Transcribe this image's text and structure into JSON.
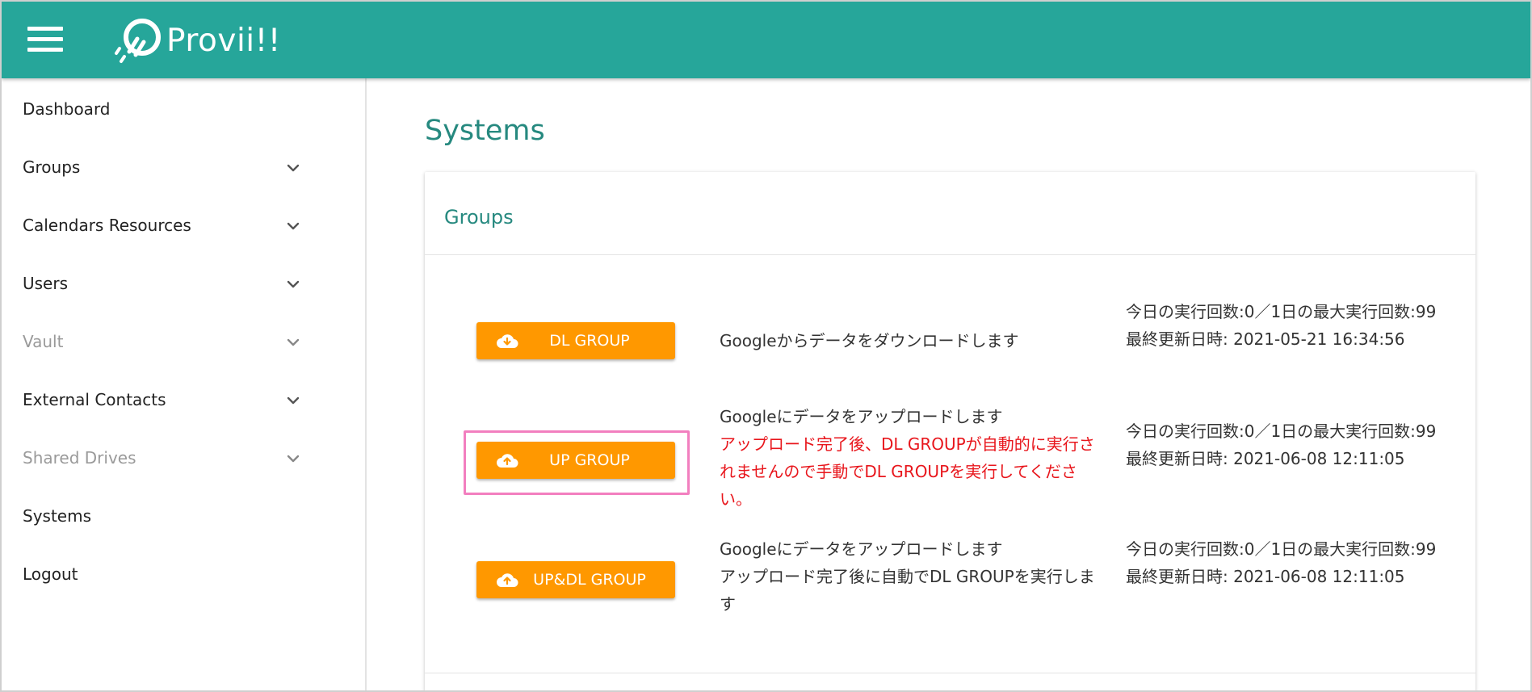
{
  "header": {
    "brand": "Provii!!",
    "accent_color": "#26a69a",
    "menu_icon": "hamburger-icon",
    "logo_icon": "provii-logo-icon"
  },
  "sidebar": {
    "items": [
      {
        "label": "Dashboard",
        "expandable": false,
        "muted": false
      },
      {
        "label": "Groups",
        "expandable": true,
        "muted": false
      },
      {
        "label": "Calendars Resources",
        "expandable": true,
        "muted": false
      },
      {
        "label": "Users",
        "expandable": true,
        "muted": false
      },
      {
        "label": "Vault",
        "expandable": true,
        "muted": true
      },
      {
        "label": "External Contacts",
        "expandable": true,
        "muted": false
      },
      {
        "label": "Shared Drives",
        "expandable": true,
        "muted": true
      },
      {
        "label": "Systems",
        "expandable": false,
        "muted": false
      },
      {
        "label": "Logout",
        "expandable": false,
        "muted": false
      }
    ]
  },
  "main": {
    "page_title": "Systems",
    "card": {
      "title": "Groups",
      "button_color": "#ff9800",
      "highlight_color": "#f27fbf",
      "rows": [
        {
          "button_label": "DL GROUP",
          "button_icon": "cloud-download-icon",
          "desc_line1": "Googleからデータをダウンロードします",
          "desc_red": "",
          "desc_rest": "",
          "stats_line1": "今日の実行回数:0／1日の最大実行回数:99",
          "stats_line2": "最終更新日時: 2021-05-21 16:34:56"
        },
        {
          "button_label": "UP GROUP",
          "button_icon": "cloud-upload-icon",
          "desc_line1": "Googleにデータをアップロードします",
          "desc_red": "アップロード完了後、DL GROUPが自動的に実行されませんので手動でDL GROUPを実行してください。",
          "desc_rest": "",
          "stats_line1": "今日の実行回数:0／1日の最大実行回数:99",
          "stats_line2": "最終更新日時: 2021-06-08 12:11:05"
        },
        {
          "button_label": "UP&DL GROUP",
          "button_icon": "cloud-upload-icon",
          "desc_line1": "Googleにデータをアップロードします",
          "desc_red": "",
          "desc_rest": "アップロード完了後に自動でDL GROUPを実行します",
          "stats_line1": "今日の実行回数:0／1日の最大実行回数:99",
          "stats_line2": "最終更新日時: 2021-06-08 12:11:05"
        }
      ]
    }
  }
}
